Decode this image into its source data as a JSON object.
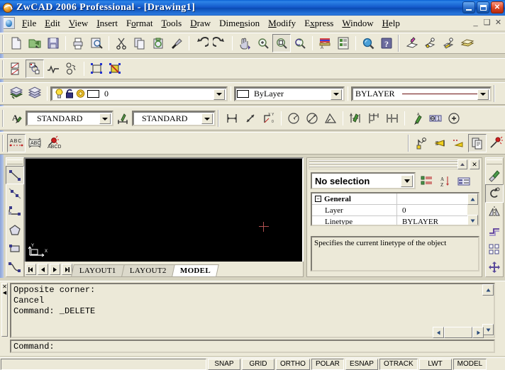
{
  "window": {
    "title": "ZwCAD 2006 Professional - [Drawing1]",
    "app_icon": "zwcad-logo-icon",
    "minimize": "minimize-icon",
    "maximize": "maximize-icon",
    "close": "close-icon",
    "mdi_minimize": "_",
    "mdi_restore": "restore-icon",
    "mdi_close": "x"
  },
  "menu": {
    "doc_icon": "document-icon",
    "items": [
      {
        "label": "File",
        "accel": "F"
      },
      {
        "label": "Edit",
        "accel": "E"
      },
      {
        "label": "View",
        "accel": "V"
      },
      {
        "label": "Insert",
        "accel": "I"
      },
      {
        "label": "Format",
        "accel": "o"
      },
      {
        "label": "Tools",
        "accel": "T"
      },
      {
        "label": "Draw",
        "accel": "D"
      },
      {
        "label": "Dimension",
        "accel": "n"
      },
      {
        "label": "Modify",
        "accel": "M"
      },
      {
        "label": "Express",
        "accel": "x"
      },
      {
        "label": "Window",
        "accel": "W"
      },
      {
        "label": "Help",
        "accel": "H"
      }
    ]
  },
  "standard_toolbar": {
    "buttons": [
      {
        "name": "new-icon",
        "tip": "New"
      },
      {
        "name": "open-icon",
        "tip": "Open"
      },
      {
        "name": "save-icon",
        "tip": "Save"
      },
      {
        "name": "print-icon",
        "tip": "Print"
      },
      {
        "name": "print-preview-icon",
        "tip": "Print Preview"
      },
      {
        "name": "cut-icon",
        "tip": "Cut"
      },
      {
        "name": "copy-icon",
        "tip": "Copy"
      },
      {
        "name": "paste-icon",
        "tip": "Paste"
      },
      {
        "name": "match-properties-icon",
        "tip": "Match Properties"
      },
      {
        "name": "undo-icon",
        "tip": "Undo"
      },
      {
        "name": "redo-icon",
        "tip": "Redo"
      },
      {
        "name": "pan-realtime-icon",
        "tip": "Pan Realtime"
      },
      {
        "name": "zoom-realtime-icon",
        "tip": "Zoom Realtime"
      },
      {
        "name": "zoom-window-icon",
        "tip": "Zoom Window",
        "pressed": true
      },
      {
        "name": "zoom-previous-icon",
        "tip": "Zoom Previous"
      },
      {
        "name": "render-icon",
        "tip": "Render"
      },
      {
        "name": "properties-icon",
        "tip": "Properties"
      },
      {
        "name": "find-icon",
        "tip": "Find"
      },
      {
        "name": "help-icon",
        "tip": "Help"
      },
      {
        "name": "ucs-icon",
        "tip": "UCS"
      },
      {
        "name": "ucs-previous-icon",
        "tip": "UCS Previous"
      },
      {
        "name": "ucs-named-icon",
        "tip": "Named UCS"
      },
      {
        "name": "ucs-display-icon",
        "tip": "Display UCS"
      }
    ]
  },
  "viewport_toolbar": {
    "buttons": [
      {
        "name": "viewports-icon",
        "tip": "Viewports"
      },
      {
        "name": "edit-viewport-icon",
        "tip": "Edit Viewport",
        "pressed": true
      },
      {
        "name": "polyline-edit-icon",
        "tip": "Polyline Edit"
      },
      {
        "name": "explode-icon",
        "tip": "Explode"
      },
      {
        "name": "select-objects-icon",
        "tip": "Select Objects"
      },
      {
        "name": "quick-select-icon",
        "tip": "Quick Select"
      }
    ]
  },
  "layer_toolbar": {
    "buttons": [
      {
        "name": "layer-manager-icon",
        "tip": "Layer Properties Manager"
      },
      {
        "name": "layer-previous-icon",
        "tip": "Layer Previous"
      }
    ],
    "layer_combo": {
      "name": "layer-combo",
      "value": "0",
      "state_icons": [
        "lightbulb-on-icon",
        "unlock-icon",
        "freeze-sun-icon",
        "plot-icon"
      ]
    },
    "color_combo": {
      "name": "color-combo",
      "value": "ByLayer",
      "swatch": "#ffffff"
    },
    "linetype_combo": {
      "name": "linetype-combo",
      "value": "BYLAYER",
      "sample_color": "#6b0f0f"
    }
  },
  "styles_toolbar": {
    "text_style_icon": "text-style-icon",
    "text_style": {
      "name": "text-style-combo",
      "value": "STANDARD"
    },
    "dim_style_icon": "dimension-style-icon",
    "dim_style": {
      "name": "dimension-style-combo",
      "value": "STANDARD"
    }
  },
  "dimension_toolbar": {
    "buttons": [
      {
        "name": "dim-linear-icon",
        "tip": "Linear Dimension"
      },
      {
        "name": "dim-aligned-icon",
        "tip": "Aligned Dimension"
      },
      {
        "name": "dim-ordinate-icon",
        "tip": "Ordinate Dimension"
      },
      {
        "name": "dim-radius-icon",
        "tip": "Radius Dimension"
      },
      {
        "name": "dim-diameter-icon",
        "tip": "Diameter Dimension"
      },
      {
        "name": "dim-angular-icon",
        "tip": "Angular Dimension"
      },
      {
        "name": "quick-dimension-icon",
        "tip": "Quick Dimension"
      },
      {
        "name": "dim-baseline-icon",
        "tip": "Baseline Dimension"
      },
      {
        "name": "dim-continue-icon",
        "tip": "Continue Dimension"
      },
      {
        "name": "quick-leader-icon",
        "tip": "Quick Leader"
      },
      {
        "name": "tolerance-icon",
        "tip": "Tolerance"
      },
      {
        "name": "center-mark-icon",
        "tip": "Center Mark"
      }
    ]
  },
  "text_toolbar": {
    "buttons": [
      {
        "name": "multiline-text-icon",
        "label": "ABC",
        "tip": "Multiline Text"
      },
      {
        "name": "spell-check-icon",
        "label": "ABC",
        "tip": "Spelling"
      },
      {
        "name": "find-replace-text-icon",
        "label": "ABCD",
        "tip": "Find and Replace"
      }
    ]
  },
  "express_toolbar": {
    "buttons": [
      {
        "name": "move-copy-rotate-icon",
        "tip": "Move/Copy/Rotate"
      },
      {
        "name": "text-fit-icon",
        "tip": "Text Fit"
      },
      {
        "name": "text-mask-icon",
        "tip": "Text Mask"
      },
      {
        "name": "copy-text-icon",
        "tip": "Copy Text",
        "pressed": true
      },
      {
        "name": "explode-text-icon",
        "tip": "Explode Text"
      }
    ]
  },
  "draw_toolbar": {
    "buttons": [
      {
        "name": "line-icon",
        "tip": "Line",
        "pressed": true
      },
      {
        "name": "construction-line-icon",
        "tip": "Construction Line"
      },
      {
        "name": "arc-icon",
        "tip": "Arc"
      },
      {
        "name": "polygon-icon",
        "tip": "Polygon"
      },
      {
        "name": "rectangle-icon",
        "tip": "Rectangle"
      },
      {
        "name": "spline-icon",
        "tip": "Spline"
      }
    ]
  },
  "modify_toolbar": {
    "buttons": [
      {
        "name": "erase-icon",
        "tip": "Erase"
      },
      {
        "name": "rotate-icon",
        "tip": "Rotate",
        "pressed": true
      },
      {
        "name": "mirror-icon",
        "tip": "Mirror"
      },
      {
        "name": "offset-icon",
        "tip": "Offset"
      },
      {
        "name": "array-icon",
        "tip": "Array"
      },
      {
        "name": "move-icon",
        "tip": "Move"
      }
    ]
  },
  "drawing_area": {
    "background": "#000000",
    "crosshair_color": "#b05050",
    "ucs_icon": "ucs-axis-icon"
  },
  "layout_tabs": {
    "nav": [
      {
        "name": "tab-nav-first",
        "glyph": "first"
      },
      {
        "name": "tab-nav-prev",
        "glyph": "prev"
      },
      {
        "name": "tab-nav-next",
        "glyph": "next"
      },
      {
        "name": "tab-nav-last",
        "glyph": "last"
      }
    ],
    "tabs": [
      {
        "label": "LAYOUT1",
        "active": false
      },
      {
        "label": "LAYOUT2",
        "active": false
      },
      {
        "label": "MODEL",
        "active": true
      }
    ]
  },
  "properties_palette": {
    "title_grip": "palette-grip",
    "autohide": "autohide-icon",
    "close": "close-icon",
    "selection": {
      "name": "selection-combo",
      "value": "No selection"
    },
    "toolbar": [
      {
        "name": "toggle-categorized-icon",
        "tip": "Categorized"
      },
      {
        "name": "toggle-alphabetical-icon",
        "tip": "Alphabetical"
      },
      {
        "name": "quick-select-icon",
        "tip": "Quick Select"
      }
    ],
    "rows": [
      {
        "name": "General",
        "value": "",
        "header": true,
        "expander": "-"
      },
      {
        "name": "Layer",
        "value": "0",
        "header": false
      },
      {
        "name": "Linetype",
        "value": "BYLAYER",
        "header": false
      }
    ],
    "description": "Specifies the current linetype of the object",
    "scroll_up": "scroll-up-icon",
    "scroll_down": "scroll-down-icon"
  },
  "command_window": {
    "history": [
      "Opposite corner:",
      "Cancel",
      "Command: _DELETE"
    ],
    "prompt": "Command:",
    "scroll_up": "scroll-up-icon",
    "scroll_down": "scroll-down-icon",
    "scroll_left": "scroll-left-icon",
    "scroll_right": "scroll-right-icon",
    "close": "close-icon"
  },
  "status_bar": {
    "coordinates": "",
    "toggles": [
      {
        "label": "SNAP",
        "on": false
      },
      {
        "label": "GRID",
        "on": false
      },
      {
        "label": "ORTHO",
        "on": false
      },
      {
        "label": "POLAR",
        "on": true
      },
      {
        "label": "ESNAP",
        "on": false
      },
      {
        "label": "OTRACK",
        "on": true
      },
      {
        "label": "LWT",
        "on": false
      },
      {
        "label": "MODEL",
        "on": true
      }
    ]
  },
  "colors": {
    "title_blue": "#1257c8",
    "face": "#ece9d8",
    "shadow": "#808080",
    "canvas": "#000000"
  }
}
